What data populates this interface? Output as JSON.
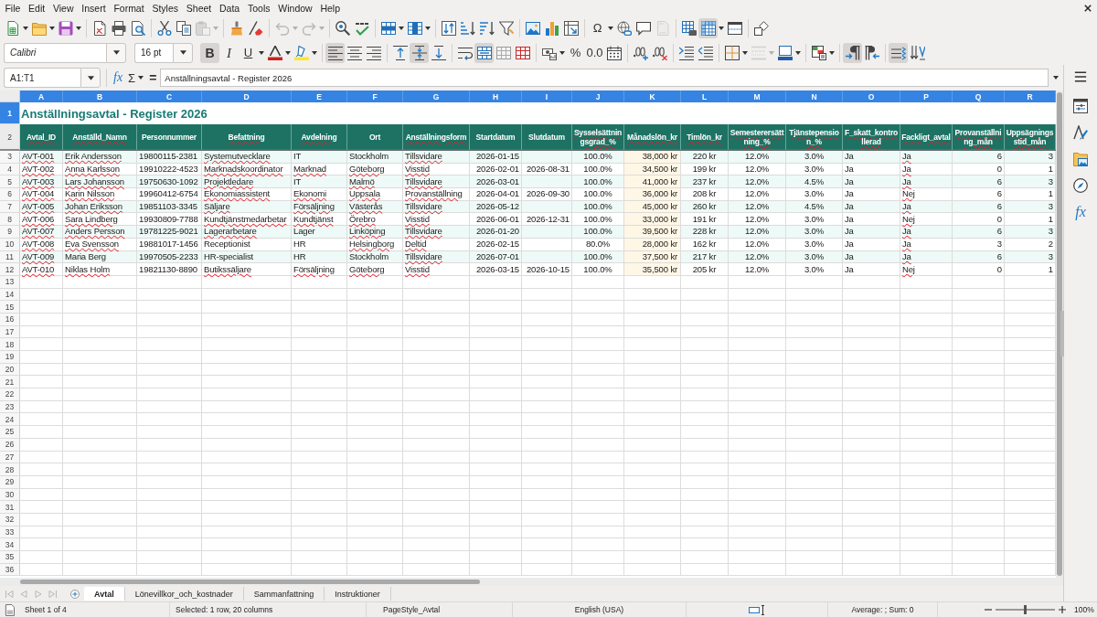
{
  "menu": [
    "File",
    "Edit",
    "View",
    "Insert",
    "Format",
    "Styles",
    "Sheet",
    "Data",
    "Tools",
    "Window",
    "Help"
  ],
  "standard_toolbar": [
    {
      "on": false,
      "disabled": false
    },
    {
      "on": false,
      "disabled": false
    },
    {
      "on": false,
      "disabled": false
    },
    {
      "on": false,
      "disabled": false
    },
    {
      "on": false,
      "disabled": false
    },
    {
      "on": false,
      "disabled": false
    },
    {
      "on": false,
      "disabled": false
    },
    {
      "on": false,
      "disabled": false
    },
    {
      "on": false,
      "disabled": true
    },
    {
      "on": false,
      "disabled": false
    },
    {
      "on": false,
      "disabled": false
    },
    {
      "on": false,
      "disabled": true
    },
    {
      "on": false,
      "disabled": true
    },
    {
      "on": false,
      "disabled": false
    },
    {
      "on": false,
      "disabled": false
    },
    {
      "on": false,
      "disabled": false
    },
    {
      "on": false,
      "disabled": false
    },
    {
      "on": false,
      "disabled": false
    },
    {
      "on": false,
      "disabled": false
    },
    {
      "on": false,
      "disabled": false
    },
    {
      "on": false,
      "disabled": false
    },
    {
      "on": false,
      "disabled": false
    },
    {
      "on": false,
      "disabled": false
    },
    {
      "on": false,
      "disabled": false
    },
    {
      "label": "Ω",
      "on": false,
      "disabled": false
    },
    {
      "on": false,
      "disabled": false
    },
    {
      "on": false,
      "disabled": false
    },
    {
      "on": false,
      "disabled": true
    },
    {
      "on": false,
      "disabled": false
    },
    {
      "on": true,
      "disabled": false
    },
    {
      "on": false,
      "disabled": false
    },
    {
      "on": false,
      "disabled": false
    }
  ],
  "formatting_toolbar": {
    "font_name": "Calibri",
    "font_size": "16 pt",
    "buttons": [
      {
        "label": "B",
        "on": true,
        "disabled": false
      },
      {
        "label": "I",
        "on": false,
        "disabled": false
      },
      {
        "label": "U",
        "on": false,
        "disabled": false
      },
      {
        "on": false,
        "disabled": false
      },
      {
        "on": false,
        "disabled": false
      },
      {
        "on": true,
        "disabled": false
      },
      {
        "on": false,
        "disabled": false
      },
      {
        "on": false,
        "disabled": false
      },
      {
        "on": false,
        "disabled": false
      },
      {
        "on": true,
        "disabled": false
      },
      {
        "on": false,
        "disabled": false
      },
      {
        "on": false,
        "disabled": false
      },
      {
        "on": true,
        "disabled": false
      },
      {
        "on": false,
        "disabled": false
      },
      {
        "on": false,
        "disabled": false
      },
      {
        "on": false,
        "disabled": false
      },
      {
        "label": "%",
        "on": false,
        "disabled": false
      },
      {
        "label": "0.0",
        "on": false,
        "disabled": false
      },
      {
        "on": false,
        "disabled": false
      },
      {
        "on": false,
        "disabled": false
      },
      {
        "on": false,
        "disabled": false
      },
      {
        "on": false,
        "disabled": false
      },
      {
        "on": false,
        "disabled": false
      },
      {
        "on": false,
        "disabled": false
      },
      {
        "on": false,
        "disabled": true
      },
      {
        "on": false,
        "disabled": false
      },
      {
        "on": false,
        "disabled": false
      },
      {
        "on": true,
        "disabled": false
      },
      {
        "on": false,
        "disabled": false
      },
      {
        "on": true,
        "disabled": false
      },
      {
        "on": false,
        "disabled": false
      }
    ]
  },
  "formula_bar": {
    "name_box": "A1:T1",
    "function_wizard": "fx",
    "sum": "Σ",
    "equals": "=",
    "content": "Anställningsavtal - Register 2026"
  },
  "sidebar": {
    "functions_tab": "fx"
  },
  "sheet": {
    "columns": [
      {
        "label": "A",
        "selected": true,
        "kind": "text"
      },
      {
        "label": "B",
        "selected": true,
        "kind": "text"
      },
      {
        "label": "C",
        "selected": true,
        "kind": "text"
      },
      {
        "label": "D",
        "selected": true,
        "kind": "text"
      },
      {
        "label": "E",
        "selected": true,
        "kind": "text"
      },
      {
        "label": "F",
        "selected": true,
        "kind": "text"
      },
      {
        "label": "G",
        "selected": true,
        "kind": "text"
      },
      {
        "label": "H",
        "selected": true,
        "kind": "date"
      },
      {
        "label": "I",
        "selected": true,
        "kind": "date"
      },
      {
        "label": "J",
        "selected": true,
        "kind": "percent"
      },
      {
        "label": "K",
        "selected": true,
        "kind": "salary"
      },
      {
        "label": "L",
        "selected": true,
        "kind": "rate"
      },
      {
        "label": "M",
        "selected": true,
        "kind": "percent"
      },
      {
        "label": "N",
        "selected": true,
        "kind": "percent"
      },
      {
        "label": "O",
        "selected": true,
        "kind": "text"
      },
      {
        "label": "P",
        "selected": true,
        "kind": "text"
      },
      {
        "label": "Q",
        "selected": true,
        "kind": "count"
      },
      {
        "label": "R",
        "selected": true,
        "kind": "count"
      }
    ],
    "title_row": {
      "number": "1",
      "selected": true,
      "text": "Anställningsavtal - Register 2026"
    },
    "header_row": {
      "number": "2",
      "selected": false,
      "cells": [
        {
          "text": "Avtal_ID",
          "misspelled": true
        },
        {
          "text": "Anställd_Namn",
          "misspelled": true
        },
        {
          "text": "Personnummer",
          "misspelled": false
        },
        {
          "text": "Befattning",
          "misspelled": true
        },
        {
          "text": "Avdelning",
          "misspelled": true
        },
        {
          "text": "Ort",
          "misspelled": false
        },
        {
          "text": "Anställningsform",
          "misspelled": true
        },
        {
          "text": "Startdatum",
          "misspelled": false
        },
        {
          "text": "Slutdatum",
          "misspelled": false
        },
        {
          "text": "Sysselsättningsgrad_%",
          "misspelled": true
        },
        {
          "text": "Månadslön_kr",
          "misspelled": true
        },
        {
          "text": "Timlön_kr",
          "misspelled": true
        },
        {
          "text": "Semesterersättning_%",
          "misspelled": true
        },
        {
          "text": "Tjänstepension_%",
          "misspelled": true
        },
        {
          "text": "F_skatt_kontrollerad",
          "misspelled": true
        },
        {
          "text": "Fackligt_avtal",
          "misspelled": true
        },
        {
          "text": "Provanställning_mån",
          "misspelled": true
        },
        {
          "text": "Uppsägningsstid_mån",
          "misspelled": true
        }
      ]
    },
    "rows": [
      {
        "number": "3",
        "selected": false,
        "cells": [
          {
            "text": "AVT-001",
            "misspelled": true
          },
          {
            "text": "Erik Andersson",
            "misspelled": true
          },
          {
            "text": "19800115-2381",
            "misspelled": false
          },
          {
            "text": "Systemutvecklare",
            "misspelled": true
          },
          {
            "text": "IT",
            "misspelled": false
          },
          {
            "text": "Stockholm",
            "misspelled": false
          },
          {
            "text": "Tillsvidare",
            "misspelled": true
          },
          {
            "text": "2026-01-15",
            "misspelled": false
          },
          null,
          {
            "text": "100.0%",
            "misspelled": false
          },
          {
            "text": "38,000 kr",
            "misspelled": false
          },
          {
            "text": "220 kr",
            "misspelled": false
          },
          {
            "text": "12.0%",
            "misspelled": false
          },
          {
            "text": "3.0%",
            "misspelled": false
          },
          {
            "text": "Ja",
            "misspelled": false
          },
          {
            "text": "Ja",
            "misspelled": true
          },
          {
            "text": "6",
            "misspelled": false
          },
          {
            "text": "3",
            "misspelled": false
          }
        ]
      },
      {
        "number": "4",
        "selected": false,
        "cells": [
          {
            "text": "AVT-002",
            "misspelled": true
          },
          {
            "text": "Anna Karlsson",
            "misspelled": true
          },
          {
            "text": "19910222-4523",
            "misspelled": false
          },
          {
            "text": "Marknadskoordinator",
            "misspelled": true
          },
          {
            "text": "Marknad",
            "misspelled": true
          },
          {
            "text": "Göteborg",
            "misspelled": true
          },
          {
            "text": "Visstid",
            "misspelled": true
          },
          {
            "text": "2026-02-01",
            "misspelled": false
          },
          {
            "text": "2026-08-31",
            "misspelled": false
          },
          {
            "text": "100.0%",
            "misspelled": false
          },
          {
            "text": "34,500 kr",
            "misspelled": false
          },
          {
            "text": "199 kr",
            "misspelled": false
          },
          {
            "text": "12.0%",
            "misspelled": false
          },
          {
            "text": "3.0%",
            "misspelled": false
          },
          {
            "text": "Ja",
            "misspelled": false
          },
          {
            "text": "Ja",
            "misspelled": true
          },
          {
            "text": "0",
            "misspelled": false
          },
          {
            "text": "1",
            "misspelled": false
          }
        ]
      },
      {
        "number": "5",
        "selected": false,
        "cells": [
          {
            "text": "AVT-003",
            "misspelled": true
          },
          {
            "text": "Lars Johansson",
            "misspelled": true
          },
          {
            "text": "19750630-1092",
            "misspelled": false
          },
          {
            "text": "Projektledare",
            "misspelled": true
          },
          {
            "text": "IT",
            "misspelled": false
          },
          {
            "text": "Malmö",
            "misspelled": true
          },
          {
            "text": "Tillsvidare",
            "misspelled": true
          },
          {
            "text": "2026-03-01",
            "misspelled": false
          },
          null,
          {
            "text": "100.0%",
            "misspelled": false
          },
          {
            "text": "41,000 kr",
            "misspelled": false
          },
          {
            "text": "237 kr",
            "misspelled": false
          },
          {
            "text": "12.0%",
            "misspelled": false
          },
          {
            "text": "4.5%",
            "misspelled": false
          },
          {
            "text": "Ja",
            "misspelled": false
          },
          {
            "text": "Ja",
            "misspelled": true
          },
          {
            "text": "6",
            "misspelled": false
          },
          {
            "text": "3",
            "misspelled": false
          }
        ]
      },
      {
        "number": "6",
        "selected": false,
        "cells": [
          {
            "text": "AVT-004",
            "misspelled": true
          },
          {
            "text": "Karin Nilsson",
            "misspelled": true
          },
          {
            "text": "19960412-6754",
            "misspelled": false
          },
          {
            "text": "Ekonomiassistent",
            "misspelled": true
          },
          {
            "text": "Ekonomi",
            "misspelled": true
          },
          {
            "text": "Uppsala",
            "misspelled": true
          },
          {
            "text": "Provanställning",
            "misspelled": true
          },
          {
            "text": "2026-04-01",
            "misspelled": false
          },
          {
            "text": "2026-09-30",
            "misspelled": false
          },
          {
            "text": "100.0%",
            "misspelled": false
          },
          {
            "text": "36,000 kr",
            "misspelled": false
          },
          {
            "text": "208 kr",
            "misspelled": false
          },
          {
            "text": "12.0%",
            "misspelled": false
          },
          {
            "text": "3.0%",
            "misspelled": false
          },
          {
            "text": "Ja",
            "misspelled": false
          },
          {
            "text": "Nej",
            "misspelled": true
          },
          {
            "text": "6",
            "misspelled": false
          },
          {
            "text": "1",
            "misspelled": false
          }
        ]
      },
      {
        "number": "7",
        "selected": false,
        "cells": [
          {
            "text": "AVT-005",
            "misspelled": true
          },
          {
            "text": "Johan Eriksson",
            "misspelled": true
          },
          {
            "text": "19851103-3345",
            "misspelled": false
          },
          {
            "text": "Säljare",
            "misspelled": true
          },
          {
            "text": "Försäljning",
            "misspelled": true
          },
          {
            "text": "Västerås",
            "misspelled": true
          },
          {
            "text": "Tillsvidare",
            "misspelled": true
          },
          {
            "text": "2026-05-12",
            "misspelled": false
          },
          null,
          {
            "text": "100.0%",
            "misspelled": false
          },
          {
            "text": "45,000 kr",
            "misspelled": false
          },
          {
            "text": "260 kr",
            "misspelled": false
          },
          {
            "text": "12.0%",
            "misspelled": false
          },
          {
            "text": "4.5%",
            "misspelled": false
          },
          {
            "text": "Ja",
            "misspelled": false
          },
          {
            "text": "Ja",
            "misspelled": true
          },
          {
            "text": "6",
            "misspelled": false
          },
          {
            "text": "3",
            "misspelled": false
          }
        ]
      },
      {
        "number": "8",
        "selected": false,
        "cells": [
          {
            "text": "AVT-006",
            "misspelled": true
          },
          {
            "text": "Sara Lindberg",
            "misspelled": true
          },
          {
            "text": "19930809-7788",
            "misspelled": false
          },
          {
            "text": "Kundtjänstmedarbetar",
            "misspelled": true
          },
          {
            "text": "Kundtjänst",
            "misspelled": true
          },
          {
            "text": "Örebro",
            "misspelled": true
          },
          {
            "text": "Visstid",
            "misspelled": true
          },
          {
            "text": "2026-06-01",
            "misspelled": false
          },
          {
            "text": "2026-12-31",
            "misspelled": false
          },
          {
            "text": "100.0%",
            "misspelled": false
          },
          {
            "text": "33,000 kr",
            "misspelled": false
          },
          {
            "text": "191 kr",
            "misspelled": false
          },
          {
            "text": "12.0%",
            "misspelled": false
          },
          {
            "text": "3.0%",
            "misspelled": false
          },
          {
            "text": "Ja",
            "misspelled": false
          },
          {
            "text": "Nej",
            "misspelled": true
          },
          {
            "text": "0",
            "misspelled": false
          },
          {
            "text": "1",
            "misspelled": false
          }
        ]
      },
      {
        "number": "9",
        "selected": false,
        "cells": [
          {
            "text": "AVT-007",
            "misspelled": true
          },
          {
            "text": "Anders Persson",
            "misspelled": true
          },
          {
            "text": "19781225-9021",
            "misspelled": false
          },
          {
            "text": "Lagerarbetare",
            "misspelled": true
          },
          {
            "text": "Lager",
            "misspelled": false
          },
          {
            "text": "Linköping",
            "misspelled": true
          },
          {
            "text": "Tillsvidare",
            "misspelled": true
          },
          {
            "text": "2026-01-20",
            "misspelled": false
          },
          null,
          {
            "text": "100.0%",
            "misspelled": false
          },
          {
            "text": "39,500 kr",
            "misspelled": false
          },
          {
            "text": "228 kr",
            "misspelled": false
          },
          {
            "text": "12.0%",
            "misspelled": false
          },
          {
            "text": "3.0%",
            "misspelled": false
          },
          {
            "text": "Ja",
            "misspelled": false
          },
          {
            "text": "Ja",
            "misspelled": true
          },
          {
            "text": "6",
            "misspelled": false
          },
          {
            "text": "3",
            "misspelled": false
          }
        ]
      },
      {
        "number": "10",
        "selected": false,
        "cells": [
          {
            "text": "AVT-008",
            "misspelled": true
          },
          {
            "text": "Eva Svensson",
            "misspelled": true
          },
          {
            "text": "19881017-1456",
            "misspelled": false
          },
          {
            "text": "Receptionist",
            "misspelled": false
          },
          {
            "text": "HR",
            "misspelled": false
          },
          {
            "text": "Helsingborg",
            "misspelled": true
          },
          {
            "text": "Deltid",
            "misspelled": true
          },
          {
            "text": "2026-02-15",
            "misspelled": false
          },
          null,
          {
            "text": "80.0%",
            "misspelled": false
          },
          {
            "text": "28,000 kr",
            "misspelled": false
          },
          {
            "text": "162 kr",
            "misspelled": false
          },
          {
            "text": "12.0%",
            "misspelled": false
          },
          {
            "text": "3.0%",
            "misspelled": false
          },
          {
            "text": "Ja",
            "misspelled": false
          },
          {
            "text": "Ja",
            "misspelled": true
          },
          {
            "text": "3",
            "misspelled": false
          },
          {
            "text": "2",
            "misspelled": false
          }
        ]
      },
      {
        "number": "11",
        "selected": false,
        "cells": [
          {
            "text": "AVT-009",
            "misspelled": true
          },
          {
            "text": "Maria Berg",
            "misspelled": false
          },
          {
            "text": "19970505-2233",
            "misspelled": false
          },
          {
            "text": "HR-specialist",
            "misspelled": false
          },
          {
            "text": "HR",
            "misspelled": false
          },
          {
            "text": "Stockholm",
            "misspelled": false
          },
          {
            "text": "Tillsvidare",
            "misspelled": true
          },
          {
            "text": "2026-07-01",
            "misspelled": false
          },
          null,
          {
            "text": "100.0%",
            "misspelled": false
          },
          {
            "text": "37,500 kr",
            "misspelled": false
          },
          {
            "text": "217 kr",
            "misspelled": false
          },
          {
            "text": "12.0%",
            "misspelled": false
          },
          {
            "text": "3.0%",
            "misspelled": false
          },
          {
            "text": "Ja",
            "misspelled": false
          },
          {
            "text": "Ja",
            "misspelled": true
          },
          {
            "text": "6",
            "misspelled": false
          },
          {
            "text": "3",
            "misspelled": false
          }
        ]
      },
      {
        "number": "12",
        "selected": false,
        "cells": [
          {
            "text": "AVT-010",
            "misspelled": true
          },
          {
            "text": "Niklas Holm",
            "misspelled": true
          },
          {
            "text": "19821130-8890",
            "misspelled": false
          },
          {
            "text": "Butikssäljare",
            "misspelled": true
          },
          {
            "text": "Försäljning",
            "misspelled": true
          },
          {
            "text": "Göteborg",
            "misspelled": true
          },
          {
            "text": "Visstid",
            "misspelled": true
          },
          {
            "text": "2026-03-15",
            "misspelled": false
          },
          {
            "text": "2026-10-15",
            "misspelled": false
          },
          {
            "text": "100.0%",
            "misspelled": false
          },
          {
            "text": "35,500 kr",
            "misspelled": false
          },
          {
            "text": "205 kr",
            "misspelled": false
          },
          {
            "text": "12.0%",
            "misspelled": false
          },
          {
            "text": "3.0%",
            "misspelled": false
          },
          {
            "text": "Ja",
            "misspelled": false
          },
          {
            "text": "Nej",
            "misspelled": true
          },
          {
            "text": "0",
            "misspelled": false
          },
          {
            "text": "1",
            "misspelled": false
          }
        ]
      }
    ],
    "empty_rows": [
      {
        "number": "13",
        "selected": false
      },
      {
        "number": "14",
        "selected": false
      },
      {
        "number": "15",
        "selected": false
      },
      {
        "number": "16",
        "selected": false
      },
      {
        "number": "17",
        "selected": false
      },
      {
        "number": "18",
        "selected": false
      },
      {
        "number": "19",
        "selected": false
      },
      {
        "number": "20",
        "selected": false
      },
      {
        "number": "21",
        "selected": false
      },
      {
        "number": "22",
        "selected": false
      },
      {
        "number": "23",
        "selected": false
      },
      {
        "number": "24",
        "selected": false
      },
      {
        "number": "25",
        "selected": false
      },
      {
        "number": "26",
        "selected": false
      },
      {
        "number": "27",
        "selected": false
      },
      {
        "number": "28",
        "selected": false
      },
      {
        "number": "29",
        "selected": false
      },
      {
        "number": "30",
        "selected": false
      },
      {
        "number": "31",
        "selected": false
      },
      {
        "number": "32",
        "selected": false
      },
      {
        "number": "33",
        "selected": false
      },
      {
        "number": "34",
        "selected": false
      },
      {
        "number": "35",
        "selected": false
      },
      {
        "number": "36",
        "selected": false
      }
    ]
  },
  "sheet_tabs": {
    "navigation_disabled": true,
    "tabs": [
      {
        "label": "Avtal",
        "selected": true
      },
      {
        "label": "Lönevillkor_och_kostnader",
        "selected": false
      },
      {
        "label": "Sammanfattning",
        "selected": false
      },
      {
        "label": "Instruktioner",
        "selected": false
      }
    ]
  },
  "status_bar": {
    "sheet": "Sheet 1 of 4",
    "selection": "Selected: 1 row, 20 columns",
    "page_style": "PageStyle_Avtal",
    "language": "English (USA)",
    "sum": "Average: ; Sum: 0",
    "zoom_slider": {
      "level": 0.5
    },
    "zoom": "100%"
  }
}
